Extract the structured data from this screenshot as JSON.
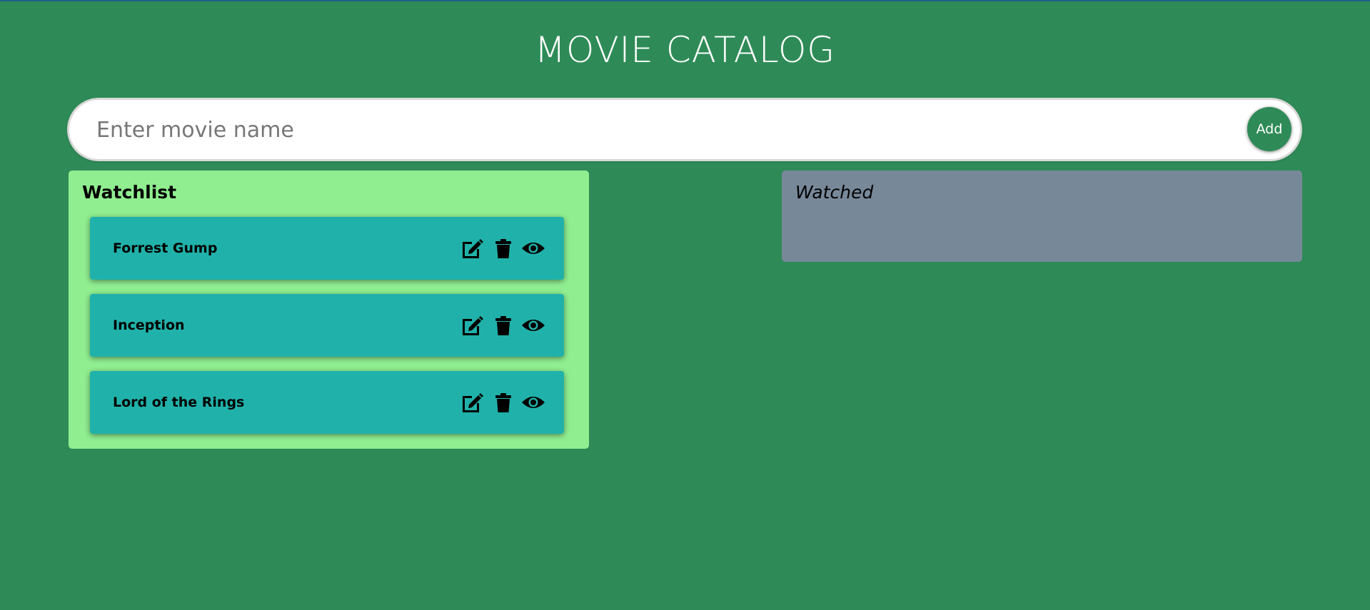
{
  "header": {
    "title": "MOVIE CATALOG"
  },
  "search": {
    "placeholder": "Enter movie name",
    "value": "",
    "add_label": "Add"
  },
  "watchlist": {
    "heading": "Watchlist",
    "movies": [
      {
        "title": "Forrest Gump"
      },
      {
        "title": "Inception"
      },
      {
        "title": "Lord of the Rings"
      }
    ],
    "actions": [
      "edit-icon",
      "trash-icon",
      "eye-icon"
    ]
  },
  "watched": {
    "heading": "Watched",
    "movies": []
  },
  "colors": {
    "background": "#2e8b57",
    "watchlist_bg": "#90ee90",
    "watched_bg": "#778899",
    "card_bg": "#20b2aa",
    "add_button_bg": "#2e8b57"
  }
}
